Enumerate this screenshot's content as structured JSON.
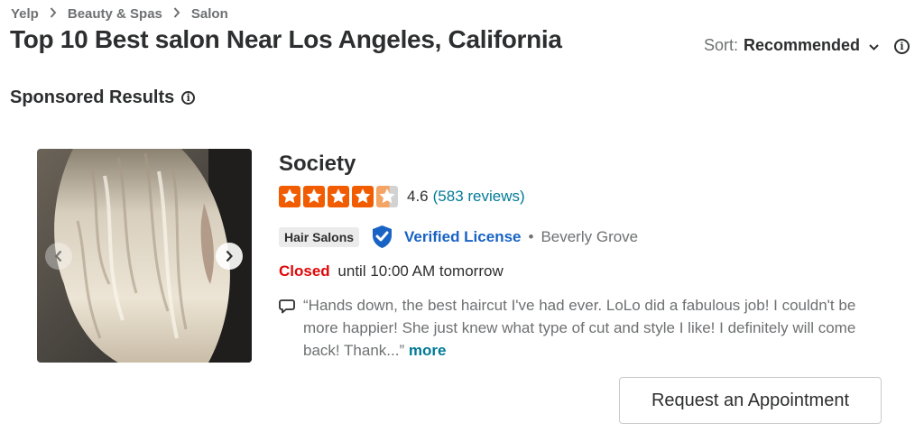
{
  "breadcrumb": [
    {
      "label": "Yelp"
    },
    {
      "label": "Beauty & Spas"
    },
    {
      "label": "Salon"
    }
  ],
  "header": {
    "title": "Top 10 Best salon Near Los Angeles, California",
    "sort_label": "Sort:",
    "sort_value": "Recommended"
  },
  "section": {
    "sponsored_label": "Sponsored Results"
  },
  "result": {
    "name": "Society",
    "rating": "4.6",
    "rating_value": 4.6,
    "review_count": "(583 reviews)",
    "category": "Hair Salons",
    "verified_label": "Verified License",
    "separator": "•",
    "neighborhood": "Beverly Grove",
    "status": "Closed",
    "hours": "until 10:00 AM tomorrow",
    "snippet": "“Hands down, the best haircut I've had ever. LoLo did a fabulous job! I couldn't be more happier! She just knew what type of cut and style I like! I definitely will come back! Thank...”",
    "more_label": "more",
    "cta_label": "Request an Appointment"
  },
  "colors": {
    "star_full": "#f15c00",
    "star_partial": "#f4a465",
    "star_empty": "#d2d2d2",
    "link": "#027a97",
    "verified": "#1863c4",
    "closed": "#e00707"
  },
  "icons": {
    "breadcrumb_separator": "chevron-right-icon",
    "sort_dropdown": "chevron-down-icon",
    "info": "info-icon",
    "verified": "shield-check-icon",
    "snippet": "speech-bubble-icon",
    "carousel_prev": "chevron-left-icon",
    "carousel_next": "chevron-right-icon"
  }
}
